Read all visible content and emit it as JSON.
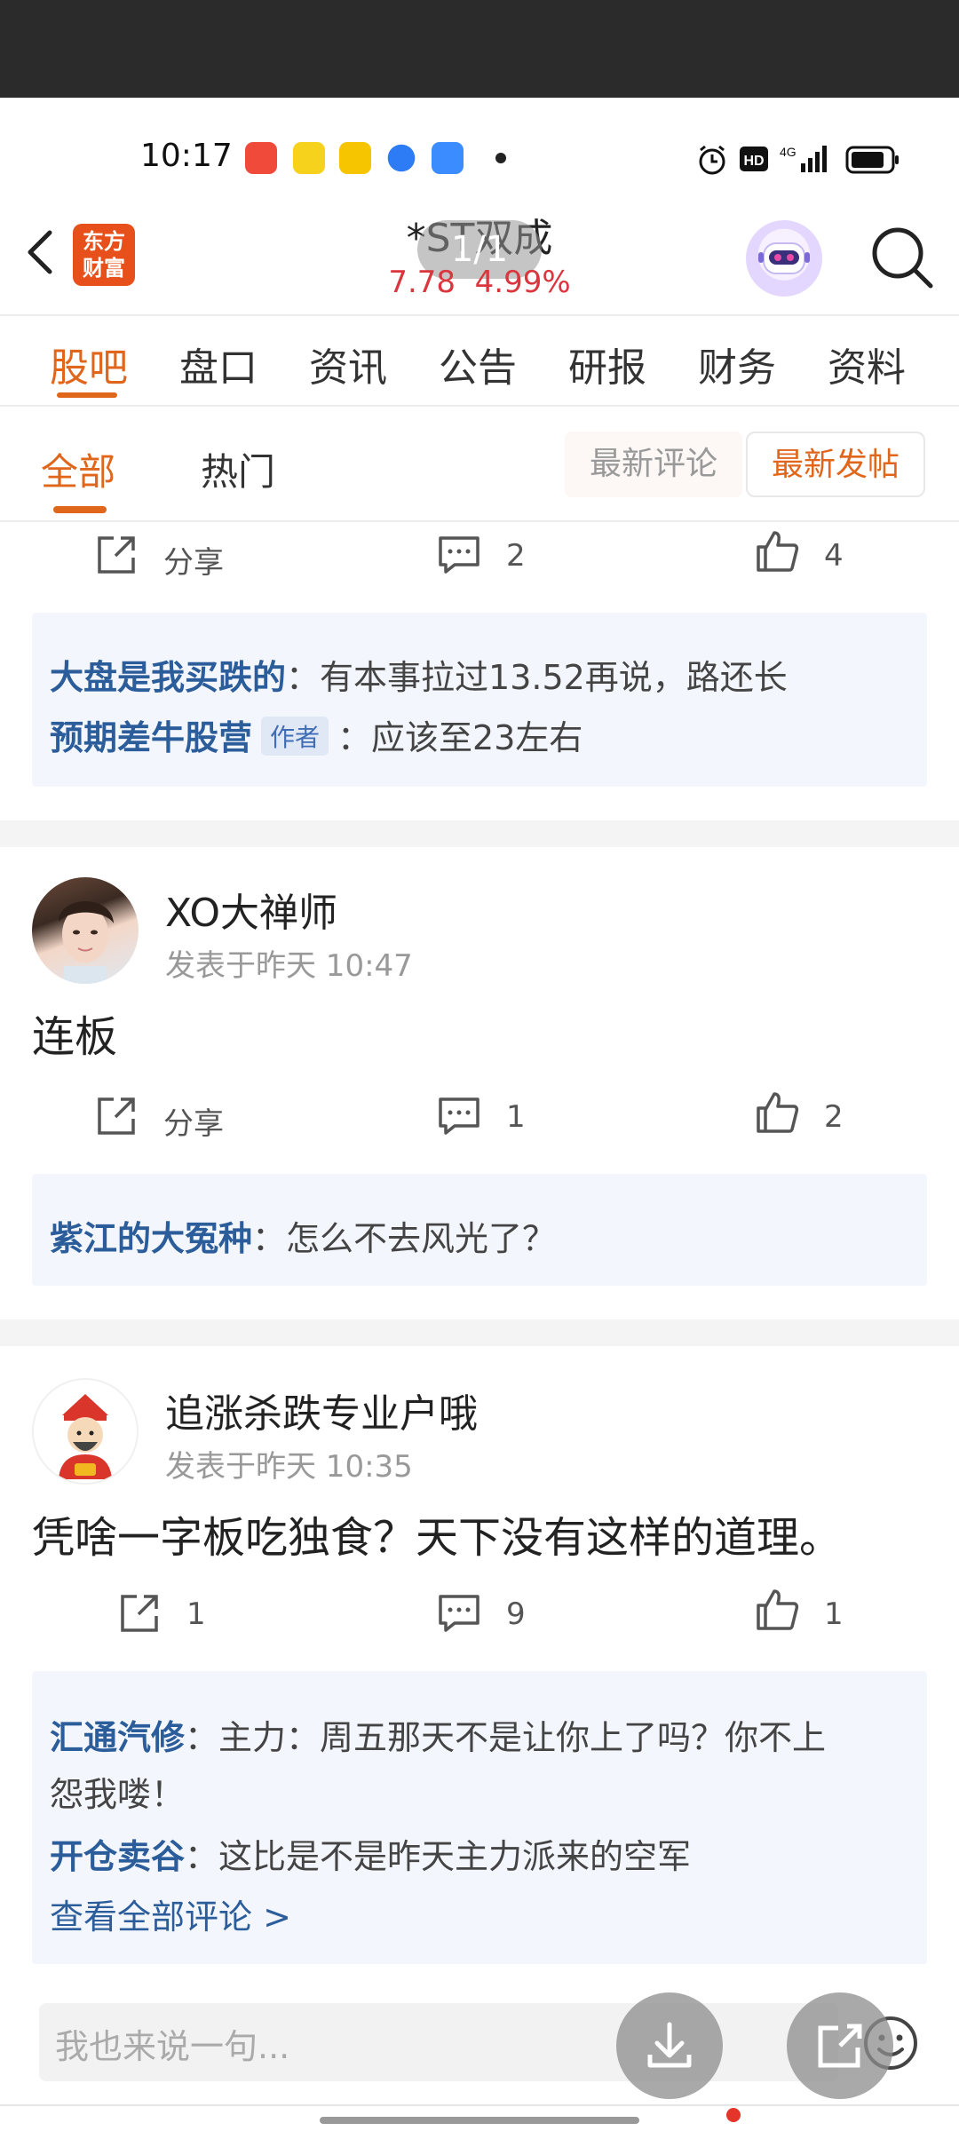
{
  "status_bar": {
    "time": "10:17",
    "app_icon_colors": [
      "#f04a3a",
      "#f6d21c",
      "#f7c500",
      "#2d7cf6",
      "#3b8cff"
    ],
    "network": "4G"
  },
  "header": {
    "logo_text": "东方财富",
    "stock_name": "*ST双成",
    "pager": "1/1",
    "price": "7.78",
    "change": "4.99%",
    "price_color": "#d9363e"
  },
  "main_tabs": [
    {
      "label": "股吧",
      "active": true
    },
    {
      "label": "盘口"
    },
    {
      "label": "资讯"
    },
    {
      "label": "公告"
    },
    {
      "label": "研报"
    },
    {
      "label": "财务"
    },
    {
      "label": "资料"
    }
  ],
  "sub_tabs": [
    {
      "label": "全部",
      "active": true
    },
    {
      "label": "热门"
    }
  ],
  "sort": {
    "latest_comment": "最新评论",
    "latest_post": "最新发帖"
  },
  "posts": [
    {
      "share_label": "分享",
      "comment_count": "2",
      "like_count": "4",
      "replies": [
        {
          "name": "大盘是我买跌的",
          "text": "：有本事拉过13.52再说，路还长",
          "author": false
        },
        {
          "name": "预期差牛股营",
          "text": "：应该至23左右",
          "author": true,
          "author_label": "作者"
        }
      ]
    },
    {
      "username": "XO大禅师",
      "time": "发表于昨天 10:47",
      "body": "连板",
      "share_label": "分享",
      "comment_count": "1",
      "like_count": "2",
      "replies": [
        {
          "name": "紫江的大冤种",
          "text": "：怎么不去风光了？"
        }
      ]
    },
    {
      "username": "追涨杀跌专业户哦",
      "time": "发表于昨天 10:35",
      "body": "凭啥一字板吃独食？天下没有这样的道理。",
      "share_count": "1",
      "comment_count": "9",
      "like_count": "1",
      "replies": [
        {
          "name": "汇通汽修",
          "text": "：主力：周五那天不是让你上了吗？你不上",
          "text2": "怨我喽！"
        },
        {
          "name": "开仓卖谷",
          "text": "：这比是不是昨天主力派来的空军"
        }
      ],
      "view_all": "查看全部评论 >"
    }
  ],
  "input": {
    "placeholder": "我也来说一句..."
  },
  "colors": {
    "accent": "#e0661b",
    "link": "#2c5d9b",
    "reply_bg": "#f3f6fc"
  }
}
